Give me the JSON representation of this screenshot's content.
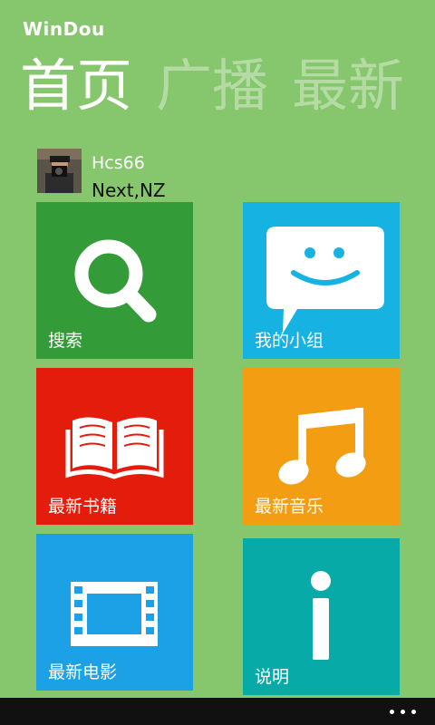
{
  "app": {
    "title": "WinDou"
  },
  "pivot": {
    "tabs": [
      "首页",
      "广播",
      "最新"
    ]
  },
  "profile": {
    "name": "Hcs66",
    "location": "Next,NZ"
  },
  "tiles": [
    {
      "label": "搜索",
      "icon": "search-icon",
      "color": "#339b37"
    },
    {
      "label": "我的小组",
      "icon": "chat-bubble-icon",
      "color": "#15b2e2"
    },
    {
      "label": "最新书籍",
      "icon": "book-icon",
      "color": "#e31c0b"
    },
    {
      "label": "最新音乐",
      "icon": "music-note-icon",
      "color": "#f29d12"
    },
    {
      "label": "最新电影",
      "icon": "film-icon",
      "color": "#1da1e6"
    },
    {
      "label": "说明",
      "icon": "info-icon",
      "color": "#07aaa7"
    }
  ],
  "appbar": {
    "more_icon": "more-dots-icon"
  }
}
